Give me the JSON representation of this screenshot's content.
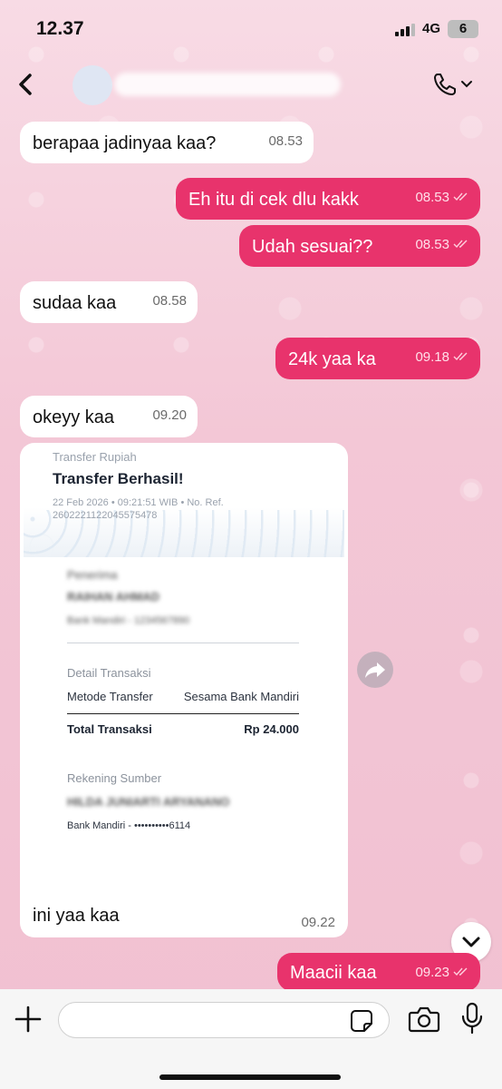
{
  "status_bar": {
    "time": "12.37",
    "network": "4G",
    "battery": "6"
  },
  "header": {
    "contact_name": "",
    "icons": [
      "back-icon",
      "phone-icon",
      "chevron-down-icon"
    ]
  },
  "messages": [
    {
      "dir": "in",
      "text": "berapaa jadinyaa kaa?",
      "time": "08.53"
    },
    {
      "dir": "out",
      "text": "Eh itu di cek dlu kakk",
      "time": "08.53"
    },
    {
      "dir": "out",
      "text": "Udah sesuai??",
      "time": "08.53"
    },
    {
      "dir": "in",
      "text": "sudaa kaa",
      "time": "08.58"
    },
    {
      "dir": "out",
      "text": "24k yaa ka",
      "time": "09.18"
    },
    {
      "dir": "in",
      "text": "okeyy kaa",
      "time": "09.20"
    }
  ],
  "receipt": {
    "header_small": "Transfer Rupiah",
    "title": "Transfer Berhasil!",
    "date_line": "22 Feb 2026 • 09:21:51 WIB • No. Ref.",
    "ref_number": "2602221122045575478",
    "recipient_label": "Penerima",
    "recipient_name": "RAIHAN AHMAD",
    "recipient_bank": "Bank Mandiri - 1234567890",
    "detail_label": "Detail Transaksi",
    "method_label": "Metode Transfer",
    "method_value": "Sesama Bank Mandiri",
    "total_label": "Total Transaksi",
    "total_value": "Rp 24.000",
    "source_label": "Rekening Sumber",
    "source_name": "HILDA JUNIARTI ARYANANO",
    "source_bank": "Bank Mandiri - ••••••••••6114",
    "caption": "ini yaa kaa",
    "time": "09.22"
  },
  "last_message": {
    "dir": "out",
    "text": "Maacii kaa",
    "time": "09.23"
  },
  "input": {
    "placeholder": ""
  },
  "colors": {
    "outgoing": "#e8336c",
    "incoming": "#ffffff",
    "wallpaper": "#f7d3df"
  }
}
